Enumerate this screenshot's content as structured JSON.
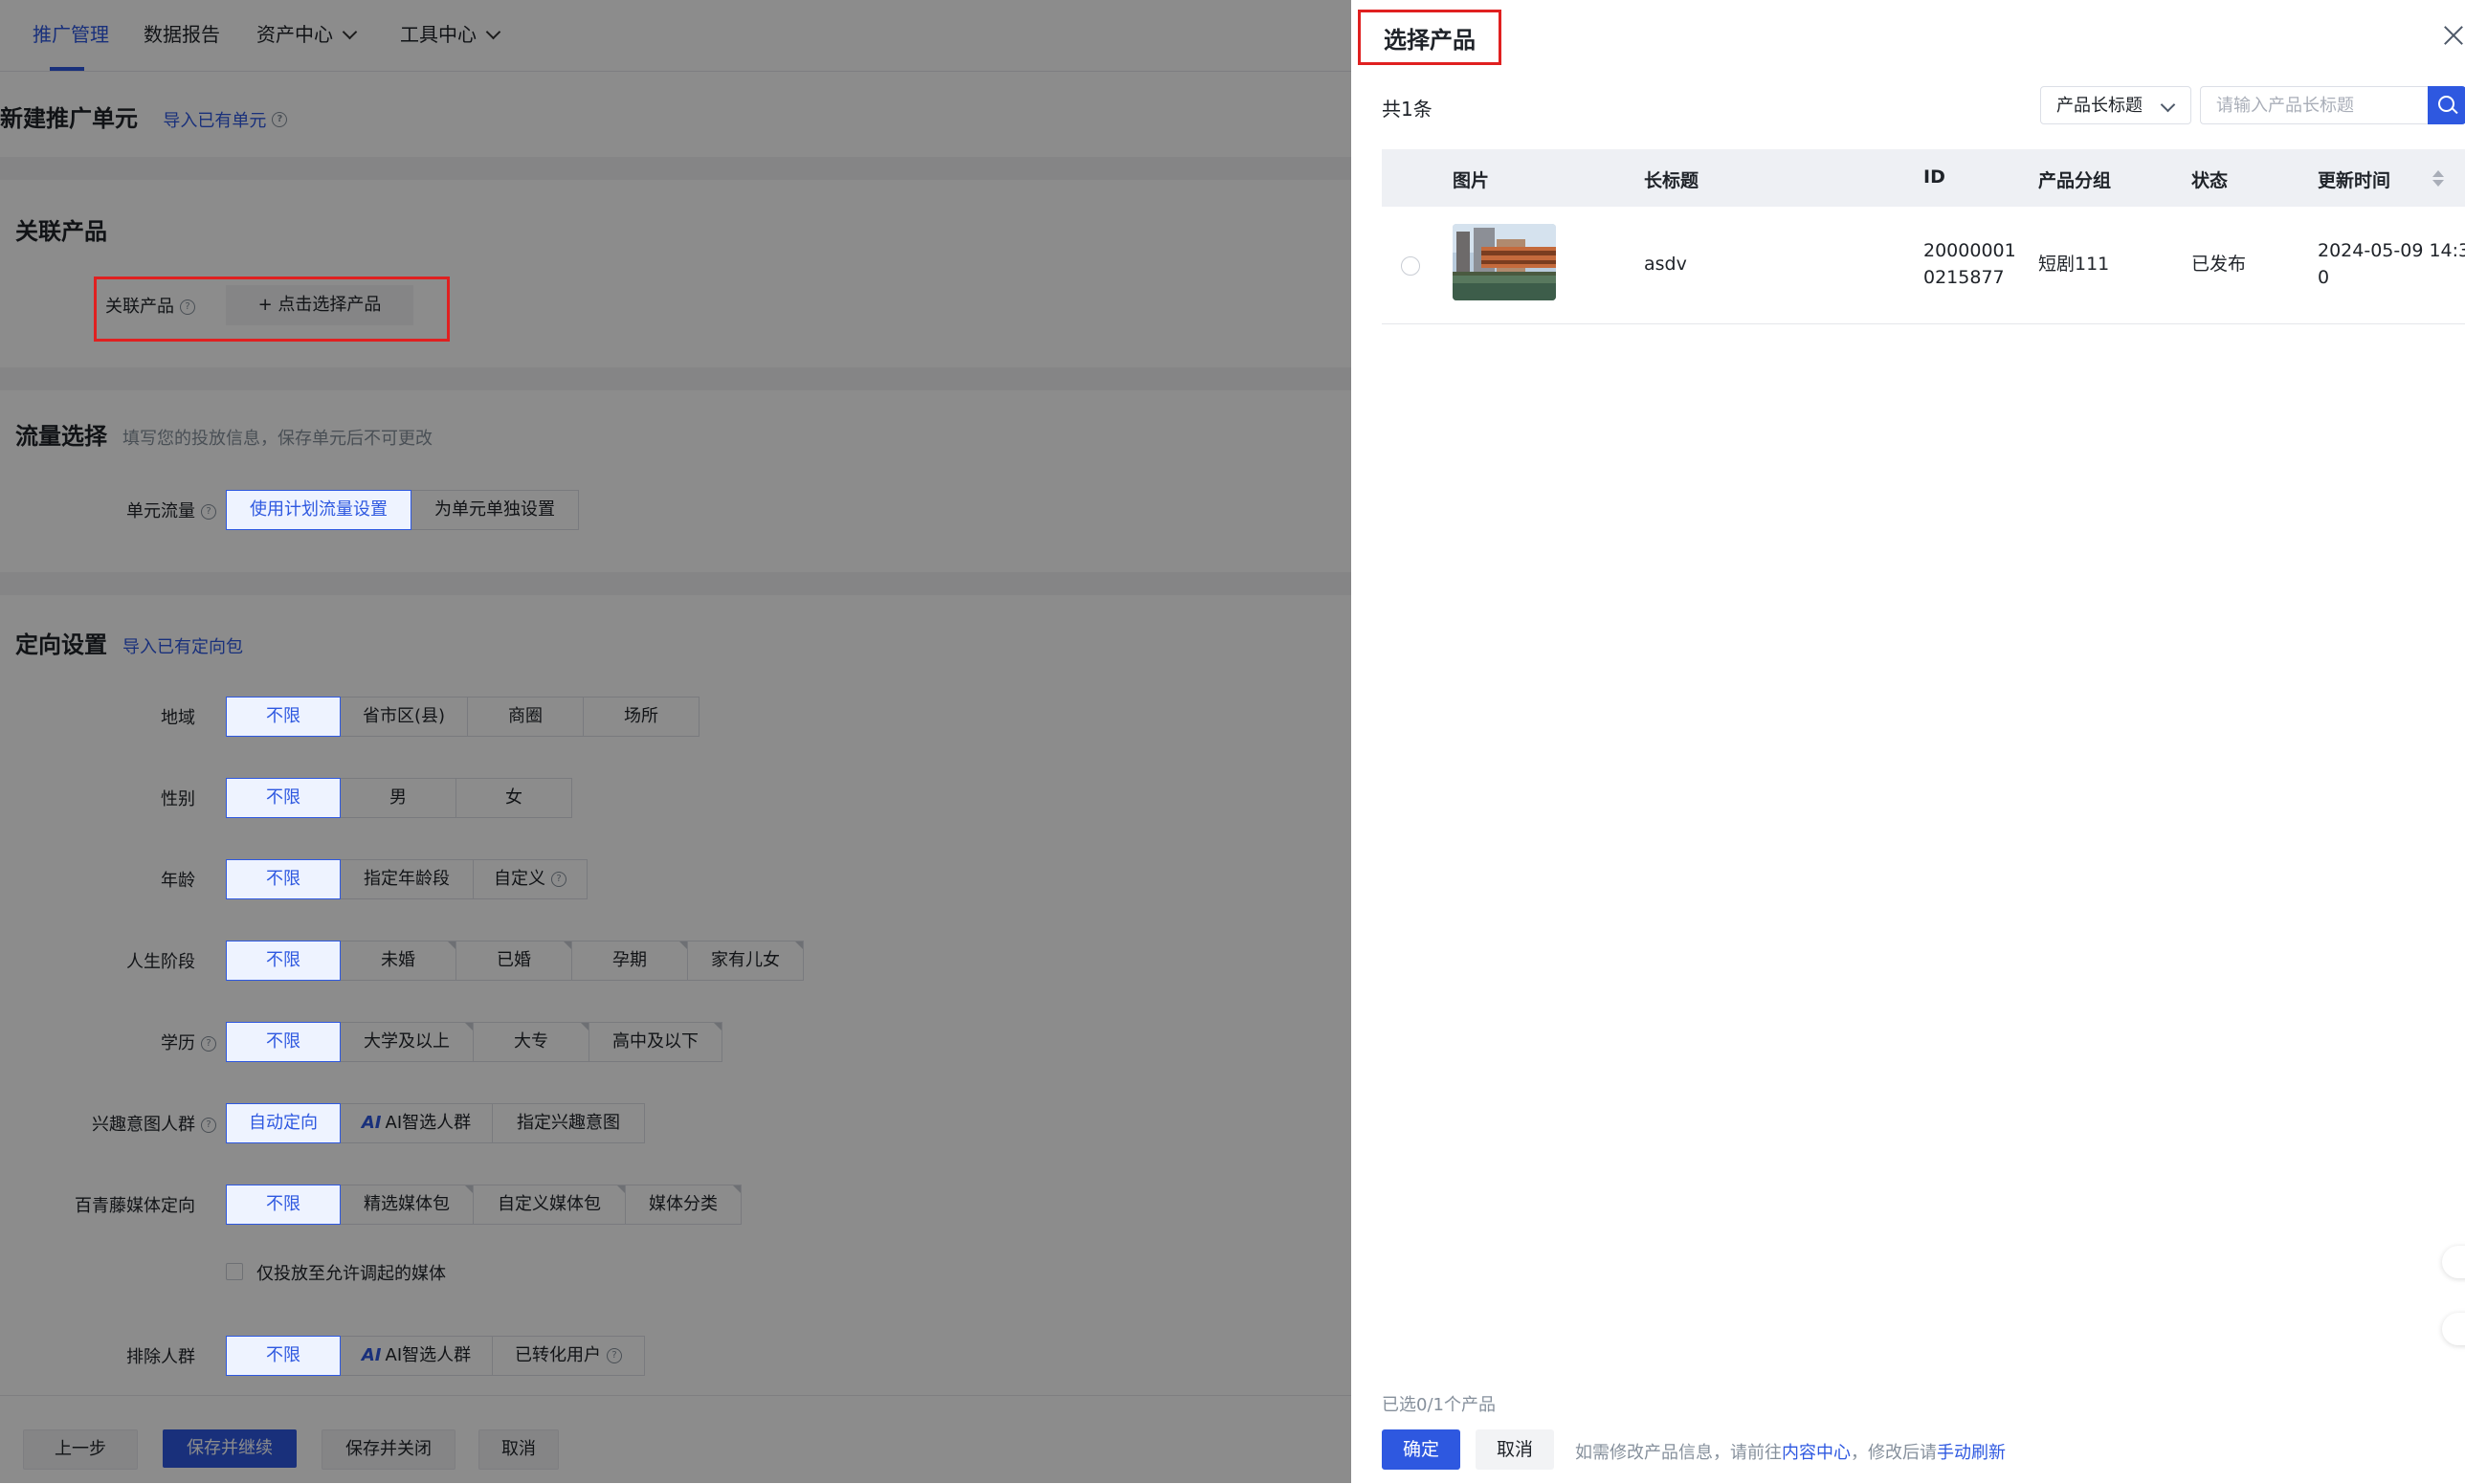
{
  "nav": {
    "items": [
      "推广管理",
      "数据报告",
      "资产中心",
      "工具中心"
    ]
  },
  "page": {
    "title": "新建推广单元",
    "import_unit_link": "导入已有单元"
  },
  "product_section": {
    "title": "关联产品",
    "label": "关联产品",
    "select_button": "+ 点击选择产品"
  },
  "traffic_section": {
    "title": "流量选择",
    "subtitle": "填写您的投放信息，保存单元后不可更改",
    "label": "单元流量",
    "options": [
      "使用计划流量设置",
      "为单元单独设置"
    ]
  },
  "targeting_section": {
    "title": "定向设置",
    "import_link": "导入已有定向包",
    "rows": [
      {
        "label": "地域",
        "options": [
          "不限",
          "省市区(县)",
          "商圈",
          "场所"
        ]
      },
      {
        "label": "性别",
        "options": [
          "不限",
          "男",
          "女"
        ]
      },
      {
        "label": "年龄",
        "options": [
          "不限",
          "指定年龄段",
          "自定义"
        ]
      },
      {
        "label": "人生阶段",
        "options": [
          "不限",
          "未婚",
          "已婚",
          "孕期",
          "家有儿女"
        ]
      },
      {
        "label": "学历",
        "options": [
          "不限",
          "大学及以上",
          "大专",
          "高中及以下"
        ]
      },
      {
        "label": "兴趣意图人群",
        "options": [
          "自动定向",
          "AI智选人群",
          "指定兴趣意图"
        ]
      },
      {
        "label": "百青藤媒体定向",
        "options": [
          "不限",
          "精选媒体包",
          "自定义媒体包",
          "媒体分类"
        ]
      },
      {
        "label": "排除人群",
        "options": [
          "不限",
          "AI智选人群",
          "已转化用户"
        ]
      }
    ],
    "ai_badge": "AI",
    "checkbox_label": "仅投放至允许调起的媒体"
  },
  "footer": {
    "prev": "上一步",
    "save_continue": "保存并继续",
    "save_close": "保存并关闭",
    "cancel": "取消"
  },
  "drawer": {
    "title": "选择产品",
    "total": "共1条",
    "filter_field": "产品长标题",
    "search_placeholder": "请输入产品长标题",
    "columns": [
      "图片",
      "长标题",
      "ID",
      "产品分组",
      "状态",
      "更新时间"
    ],
    "rows": [
      {
        "title": "asdv",
        "id_line1": "20000001",
        "id_line2": "0215877",
        "group": "短剧111",
        "status": "已发布",
        "updated_line1": "2024-05-09 14:3",
        "updated_line2": "0"
      }
    ],
    "selected_count": "已选0/1个产品",
    "confirm": "确定",
    "cancel": "取消",
    "hint_prefix": "如需修改产品信息，请前往",
    "hint_link1": "内容中心",
    "hint_middle": "，修改后请",
    "hint_link2": "手动刷新"
  },
  "colors": {
    "accent": "#2e58e0",
    "highlight_box": "#e02020"
  }
}
